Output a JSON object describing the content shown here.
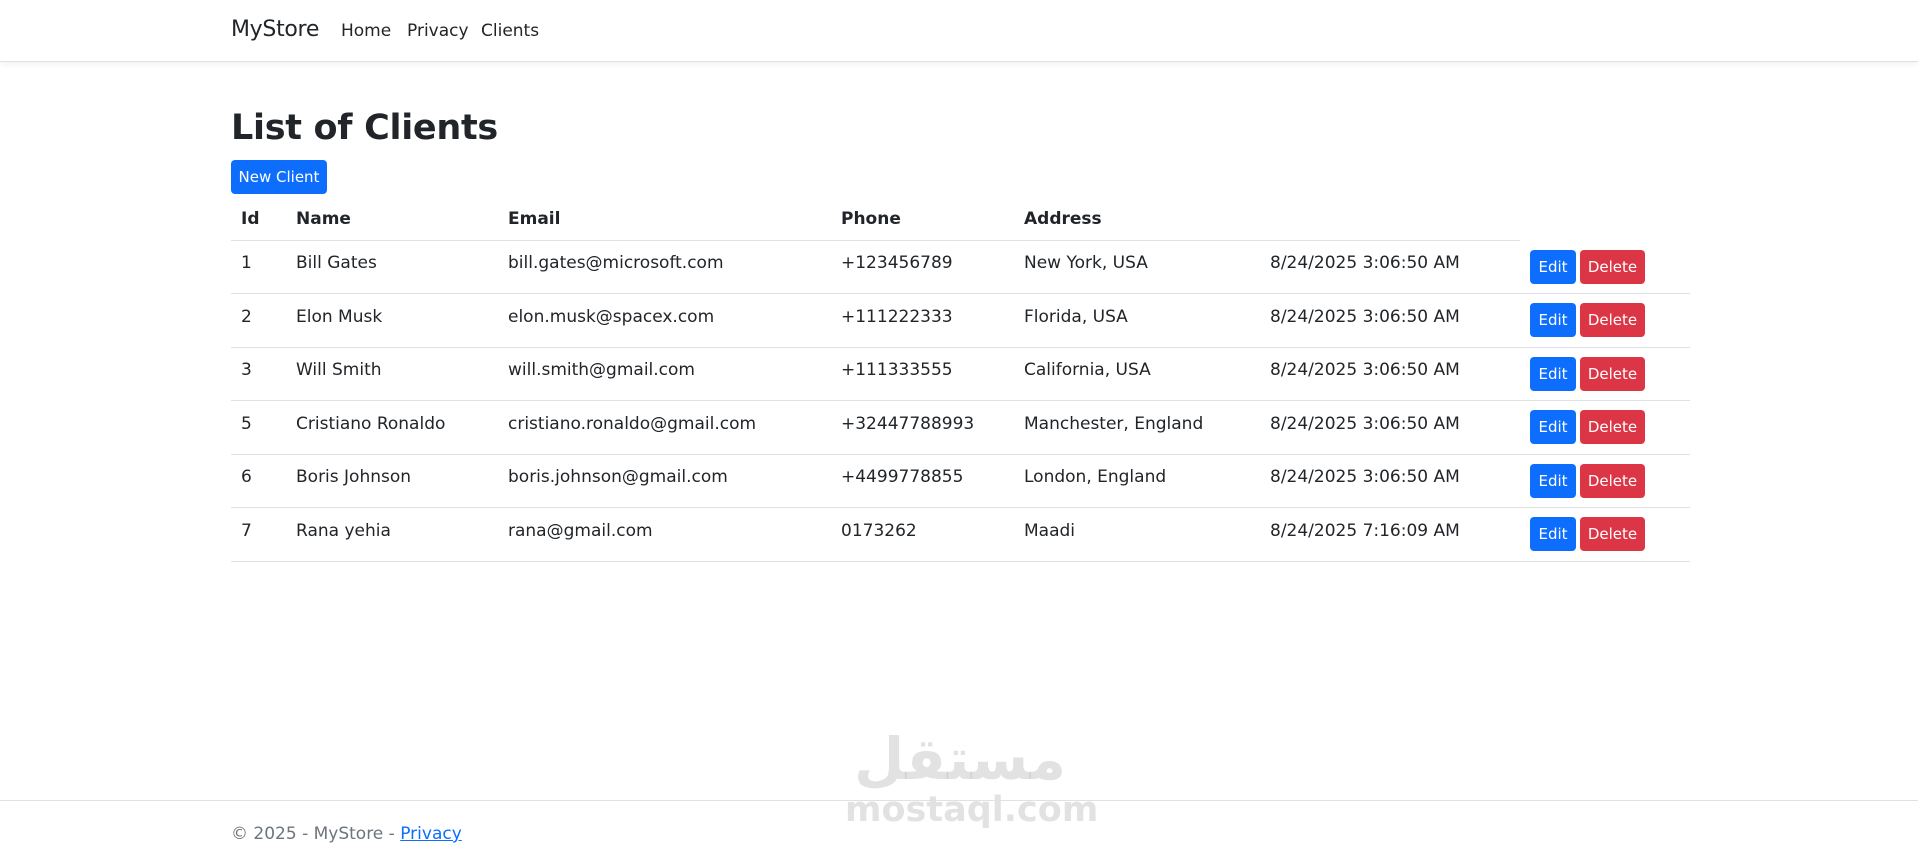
{
  "nav": {
    "brand": "MyStore",
    "links": [
      "Home",
      "Privacy",
      "Clients"
    ]
  },
  "page": {
    "title": "List of Clients",
    "new_button": "New Client"
  },
  "table": {
    "headers": [
      "Id",
      "Name",
      "Email",
      "Phone",
      "Address"
    ],
    "rows": [
      {
        "id": "1",
        "name": "Bill Gates",
        "email": "bill.gates@microsoft.com",
        "phone": "+123456789",
        "address": "New York, USA",
        "created": "8/24/2025 3:06:50 AM"
      },
      {
        "id": "2",
        "name": "Elon Musk",
        "email": "elon.musk@spacex.com",
        "phone": "+111222333",
        "address": "Florida, USA",
        "created": "8/24/2025 3:06:50 AM"
      },
      {
        "id": "3",
        "name": "Will Smith",
        "email": "will.smith@gmail.com",
        "phone": "+111333555",
        "address": "California, USA",
        "created": "8/24/2025 3:06:50 AM"
      },
      {
        "id": "5",
        "name": "Cristiano Ronaldo",
        "email": "cristiano.ronaldo@gmail.com",
        "phone": "+32447788993",
        "address": "Manchester, England",
        "created": "8/24/2025 3:06:50 AM"
      },
      {
        "id": "6",
        "name": "Boris Johnson",
        "email": "boris.johnson@gmail.com",
        "phone": "+4499778855",
        "address": "London, England",
        "created": "8/24/2025 3:06:50 AM"
      },
      {
        "id": "7",
        "name": "Rana yehia",
        "email": "rana@gmail.com",
        "phone": "0173262",
        "address": "Maadi",
        "created": "8/24/2025 7:16:09 AM"
      }
    ],
    "edit_label": "Edit",
    "delete_label": "Delete"
  },
  "footer": {
    "copyright": "© 2025 - MyStore - ",
    "privacy_link": "Privacy"
  },
  "watermark": {
    "arabic": "مستقل",
    "latin": "mostaql.com"
  },
  "colors": {
    "primary": "#0d6efd",
    "danger": "#dc3545",
    "text": "#212529",
    "muted": "#6c757d",
    "border": "#dee2e6"
  }
}
